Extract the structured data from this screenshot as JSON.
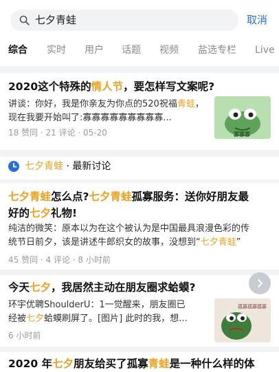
{
  "search": {
    "query": "七夕青蛙",
    "cancel_label": "取消"
  },
  "tabs": [
    {
      "label": "综合",
      "active": true
    },
    {
      "label": "实时"
    },
    {
      "label": "用户"
    },
    {
      "label": "话题"
    },
    {
      "label": "视频"
    },
    {
      "label": "盐选专栏"
    },
    {
      "label": "Live"
    }
  ],
  "card1": {
    "title_a": "2020这个特殊的",
    "title_hl": "情人节",
    "title_b": "，要怎样写文案呢?",
    "excerpt_a": "讲谈：你好，我是你亲友为你点的520祝福",
    "excerpt_hl": "青蛙",
    "excerpt_b": "，现在我要开始叫了:寡寡寡寡寡寡寡寡寡...",
    "meta": "18 赞同 · 21 评论 · 05-20",
    "thumb_text": "寡寡寡"
  },
  "section": {
    "title_hl": "七夕青蛙",
    "title_rest": " · 最新讨论"
  },
  "card2": {
    "title_l1_hl1": "七夕青蛙",
    "title_l1_a": "怎么点?",
    "title_l1_hl2": "七夕青蛙",
    "title_l1_b": "孤寡服务：送你好朋友最",
    "title_l2_a": "好的",
    "title_l2_hl": "七夕",
    "title_l2_b": "礼物!",
    "excerpt_l1": "纯洁的微笑：原本以为在这个被认为是中国最具浪漫色彩的传",
    "excerpt_l2_a": "统节日前夕，该是讲述牛郎织女的故事，没想到“",
    "excerpt_l2_hl": "七夕青蛙",
    "excerpt_l2_b": "”",
    "meta": "45 赞同 · 4 评论 · 8 小时前"
  },
  "card3": {
    "title_a": "今天",
    "title_hl": "七夕",
    "title_b": "，我居然主动在朋友圈求蛤蟆?",
    "excerpt_l1": "环宇优聘ShoulderU：1一觉醒来，朋友圈已",
    "excerpt_l2_a": "经被",
    "excerpt_l2_hl": "七夕",
    "excerpt_l2_b": "蛤蟆刷屏了。[图片] 此时的我，想...",
    "meta": "6 小时前",
    "thumb_text": "孤寡孤寡孤寡"
  },
  "card4": {
    "title_a": "2020 年",
    "title_hl1": "七夕",
    "title_b": "朋友给买了孤寡",
    "title_hl2": "青蛙",
    "title_c": "是一种什么样的体"
  },
  "colors": {
    "accent": "#2b6fd6",
    "highlight": "#f0a020"
  },
  "icons": {
    "search": "search-icon",
    "clock": "clock-icon",
    "scroll": "chevron-right-icon"
  }
}
